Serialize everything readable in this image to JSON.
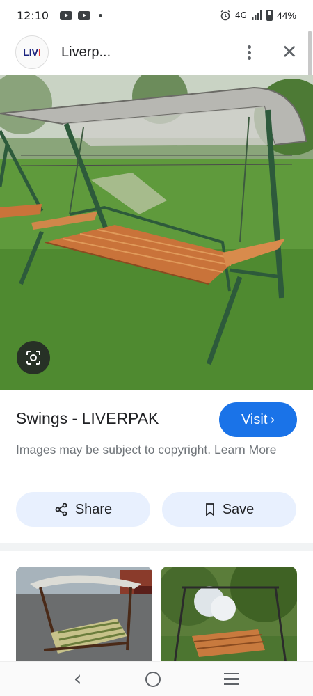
{
  "status_bar": {
    "time": "12:10",
    "network": "4G",
    "battery": "44%"
  },
  "header": {
    "logo_text": "LIV",
    "logo_accent": "I",
    "site_name": "Liverp...",
    "more_icon": "more-vert-icon",
    "close_icon": "close-icon",
    "close_glyph": "✕"
  },
  "result": {
    "title": "Swings - LIVERPAK",
    "visit_label": "Visit",
    "visit_chevron": "›",
    "copyright_text": "Images may be subject to copyright. Learn More",
    "share_label": "Share",
    "save_label": "Save"
  },
  "related": [
    {
      "name": "related-image-1"
    },
    {
      "name": "related-image-2"
    }
  ],
  "navbar": {
    "back_glyph": "‹"
  },
  "colors": {
    "accent": "#1a73e8",
    "pill_bg": "#e8f0fe"
  }
}
